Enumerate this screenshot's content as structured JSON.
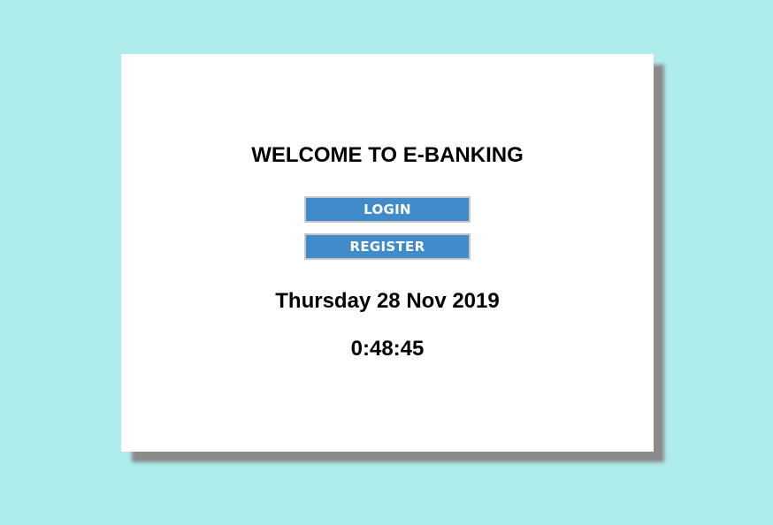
{
  "card": {
    "title": "WELCOME TO E-BANKING",
    "buttons": {
      "login_label": "LOGIN",
      "register_label": "REGISTER"
    },
    "date": "Thursday 28 Nov 2019",
    "time": "0:48:45"
  },
  "colors": {
    "page_background": "#aeecec",
    "card_background": "#ffffff",
    "button_background": "#428bca",
    "button_text": "#ffffff",
    "button_border": "#c8c8c8",
    "card_shadow": "#8a8a8a"
  }
}
